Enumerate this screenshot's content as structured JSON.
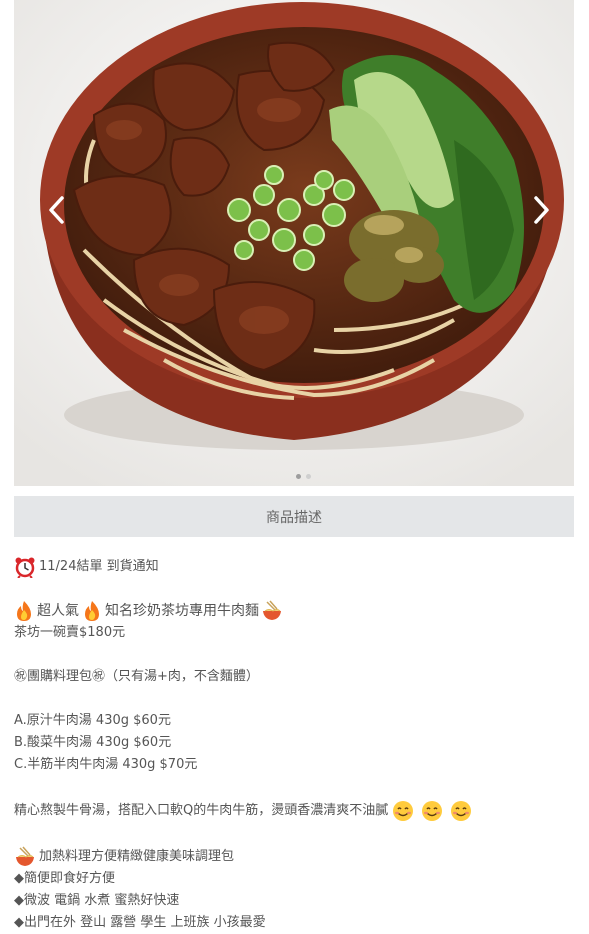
{
  "tabs": {
    "description_label": "商品描述"
  },
  "carousel": {
    "slide_count": 2,
    "active_index": 0
  },
  "icons": {
    "prev": "chevron-left-icon",
    "next": "chevron-right-icon",
    "clock": "alarm-clock-icon",
    "fire": "fire-icon",
    "noodle": "noodle-bowl-icon",
    "smile": "smiling-face-icon"
  },
  "description": {
    "notice": "11/24結單 到貨通知",
    "headline_a": "超人氣",
    "headline_b": "知名珍奶茶坊專用牛肉麵",
    "price_line": "茶坊一碗賣$180元",
    "package_line": "㊗團購料理包㊗（只有湯+肉，不含麵體）",
    "options": [
      "A.原汁牛肉湯 430g $60元",
      "B.酸菜牛肉湯 430g $60元",
      "C.半筋半肉牛肉湯 430g $70元"
    ],
    "story": "精心熬製牛骨湯，搭配入口軟Q的牛肉牛筋，燙頭香濃清爽不油膩",
    "pack_title": "加熱料理方便精緻健康美味調理包",
    "bullets": [
      "◆簡便即食好方便",
      "◆微波 電鍋 水煮 蜜熱好快速",
      "◆出門在外 登山 露營 學生 上班族 小孩最愛"
    ]
  }
}
